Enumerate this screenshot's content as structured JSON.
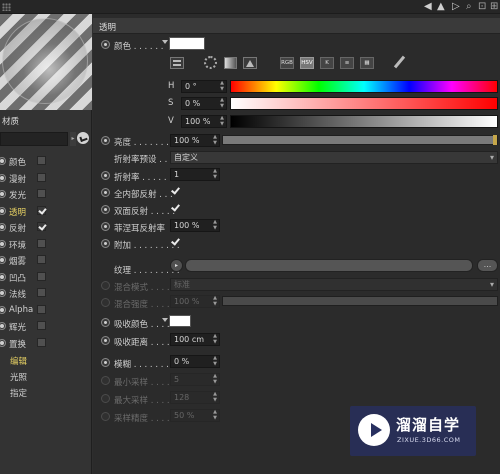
{
  "left": {
    "material_name": "材质",
    "channels": [
      {
        "label": "颜色",
        "enabled": false,
        "active": true
      },
      {
        "label": "漫射",
        "enabled": false,
        "active": true
      },
      {
        "label": "发光",
        "enabled": false,
        "active": true
      },
      {
        "label": "透明",
        "enabled": true,
        "active": true,
        "highlight": true
      },
      {
        "label": "反射",
        "enabled": true,
        "active": true
      },
      {
        "label": "环境",
        "enabled": false,
        "active": true
      },
      {
        "label": "烟雾",
        "enabled": false,
        "active": true
      },
      {
        "label": "凹凸",
        "enabled": false,
        "active": true
      },
      {
        "label": "法线",
        "enabled": false,
        "active": true
      },
      {
        "label": "Alpha",
        "enabled": false,
        "active": true
      },
      {
        "label": "辉光",
        "enabled": false,
        "active": true
      },
      {
        "label": "置换",
        "enabled": false,
        "active": true
      }
    ],
    "extra": [
      {
        "label": "编辑",
        "highlight": true
      },
      {
        "label": "光照",
        "highlight": false
      },
      {
        "label": "指定",
        "highlight": false
      }
    ]
  },
  "panel": {
    "section_title": "透明",
    "color_label": "颜色 . . . . . .",
    "color_value": "#ffffff",
    "color_tools": [
      "RGB",
      "HSV",
      "K",
      "≡",
      "▦"
    ],
    "h": {
      "label": "H",
      "value": "0 °"
    },
    "s": {
      "label": "S",
      "value": "0 %"
    },
    "v": {
      "label": "V",
      "value": "100 %"
    },
    "brightness": {
      "label": "亮度 . . . . . . . .",
      "value": "100 %",
      "fraction": 1.0
    },
    "ior_preset": {
      "label": "折射率预设 . . . .",
      "value": "自定义"
    },
    "ior": {
      "label": "折射率 . . . . . . .",
      "value": "1"
    },
    "total_internal": {
      "label": "全内部反射 . . .",
      "checked": true
    },
    "double_sided": {
      "label": "双面反射 . . . . .",
      "checked": true
    },
    "fresnel": {
      "label": "菲涅耳反射率",
      "value": "100 %"
    },
    "additive": {
      "label": "附加 . . . . . . . . .",
      "checked": true
    },
    "texture": {
      "label": "纹理 . . . . . . . . .",
      "button": "..."
    },
    "mix_mode": {
      "label": "混合模式 . . . . .",
      "value": "标准"
    },
    "mix_strength": {
      "label": "混合强度 . . . . .",
      "value": "100 %"
    },
    "absorb_color": {
      "label": "吸收颜色 . . . . .",
      "value": "#ffffff"
    },
    "absorb_distance": {
      "label": "吸收距离 . . . . .",
      "value": "100 cm"
    },
    "blur": {
      "label": "模糊 . . . . . . . . .",
      "value": "0 %"
    },
    "min_samples": {
      "label": "最小采样 . . . . .",
      "value": "5"
    },
    "max_samples": {
      "label": "最大采样 . . . . .",
      "value": "128"
    },
    "accuracy": {
      "label": "采样精度 . . . . .",
      "value": "50 %"
    }
  },
  "watermark": {
    "title": "溜溜自学",
    "subtitle": "ZIXUE.3D66.COM"
  }
}
